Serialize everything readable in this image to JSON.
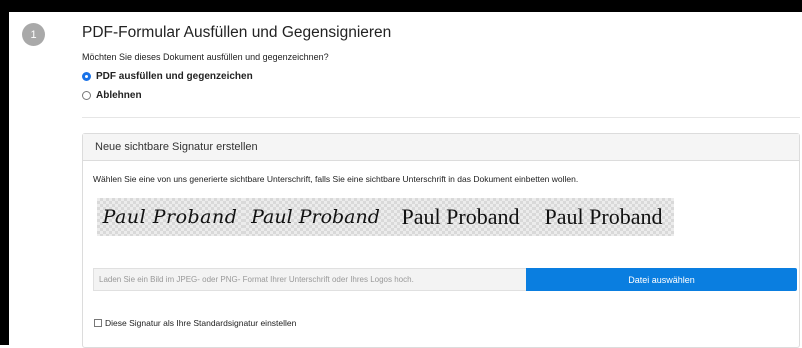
{
  "step": {
    "number": "1"
  },
  "form": {
    "title": "PDF-Formular Ausfüllen und Gegensignieren",
    "question": "Möchten Sie dieses Dokument ausfüllen und gegenzeichnen?",
    "options": [
      {
        "label": "PDF ausfüllen und gegenzeichen",
        "checked": true
      },
      {
        "label": "Ablehnen",
        "checked": false
      }
    ]
  },
  "signature_panel": {
    "header": "Neue sichtbare Signatur erstellen",
    "description": "Wählen Sie eine von uns generierte sichtbare Unterschrift, falls Sie eine sichtbare Unterschrift in das Dokument einbetten wollen.",
    "signatures": [
      "Paul Proband",
      "Paul Proband",
      "Paul Proband",
      "Paul Proband"
    ],
    "upload_placeholder": "Laden Sie ein Bild im JPEG- oder PNG- Format Ihrer Unterschrift oder Ihres Logos hoch.",
    "upload_button": "Datei auswählen",
    "default_checkbox_label": "Diese Signatur als Ihre Standardsignatur einstellen",
    "default_checked": false
  },
  "colors": {
    "accent": "#0a7ee0",
    "badge": "#a9a9a9",
    "frame": "#000000"
  }
}
